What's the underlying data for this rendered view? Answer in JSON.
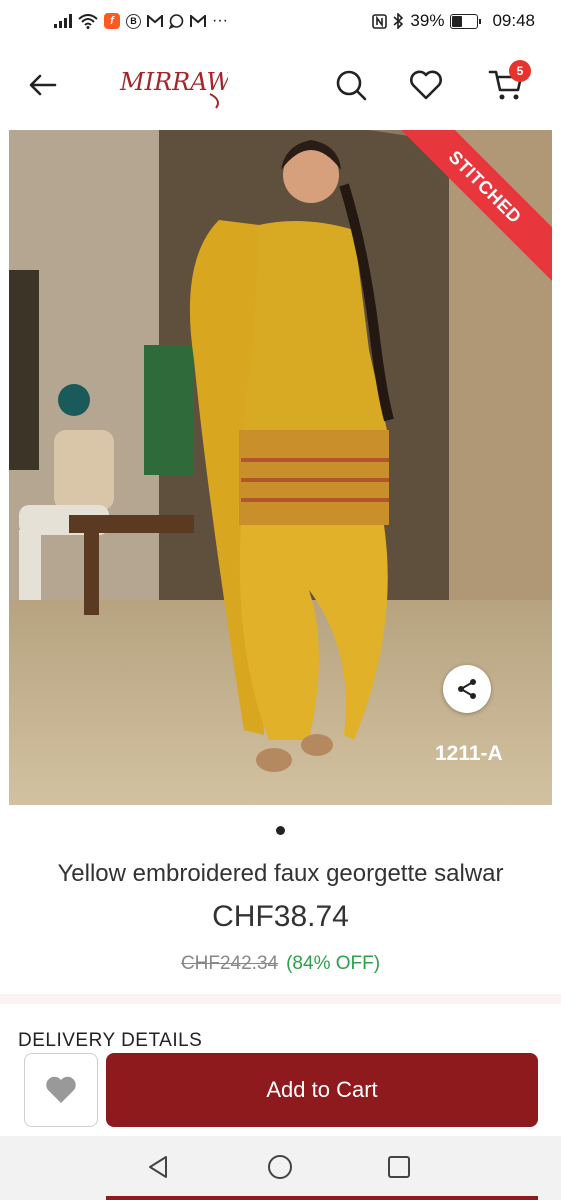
{
  "status_bar": {
    "time": "09:48",
    "battery_percent": "39%",
    "battery_level": 0.39,
    "left_icons": [
      "signal-icon",
      "wifi-icon",
      "app-f-icon",
      "b-circle-icon",
      "gmail-icon",
      "whatsapp-icon",
      "gmail-icon",
      "more-dots-icon"
    ],
    "more_dots": "···",
    "right_icons": [
      "nfc-icon",
      "bluetooth-icon",
      "battery-icon"
    ]
  },
  "header": {
    "logo_text": "MIRRAW",
    "cart_count": "5",
    "icons": [
      "back-arrow-icon",
      "search-icon",
      "heart-icon",
      "cart-icon"
    ],
    "brand_color": "#a3262b"
  },
  "product": {
    "ribbon_text": "STITCHED",
    "sku_label": "1211-A",
    "title": "Yellow embroidered faux georgette salwar",
    "price": "CHF38.74",
    "original_price": "CHF242.34",
    "discount": "(84% OFF)",
    "discount_color": "#2ea04b",
    "image_count": 1,
    "active_image": 1
  },
  "sections": {
    "delivery_heading": "DELIVERY DETAILS"
  },
  "actions": {
    "add_to_cart_label": "Add to Cart",
    "button_color": "#8e1a1e"
  },
  "nav_bar": {
    "icons": [
      "nav-back-icon",
      "nav-home-icon",
      "nav-recent-icon"
    ]
  }
}
